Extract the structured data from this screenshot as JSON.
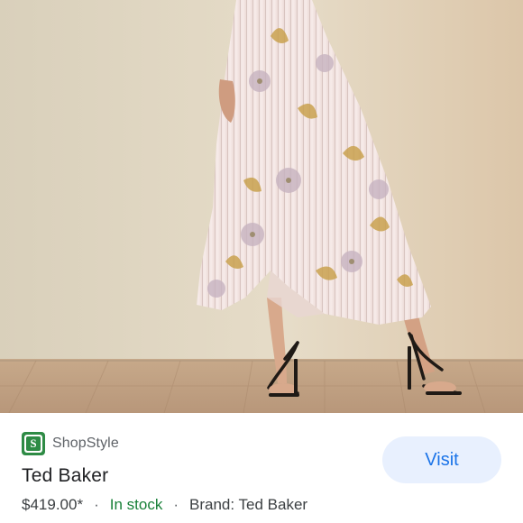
{
  "source": {
    "name": "ShopStyle",
    "logo_icon": "shopstyle-logo-icon",
    "logo_letter": "S",
    "brand_color": "#2e8b45"
  },
  "product": {
    "title": "Ted Baker",
    "price": "$419.00*",
    "separator": "·",
    "availability": "In stock",
    "brand": "Brand: Ted Baker"
  },
  "actions": {
    "visit_label": "Visit"
  },
  "colors": {
    "accent": "#1a73e8",
    "button_bg": "#e8f0fe",
    "stock_green": "#188038"
  }
}
